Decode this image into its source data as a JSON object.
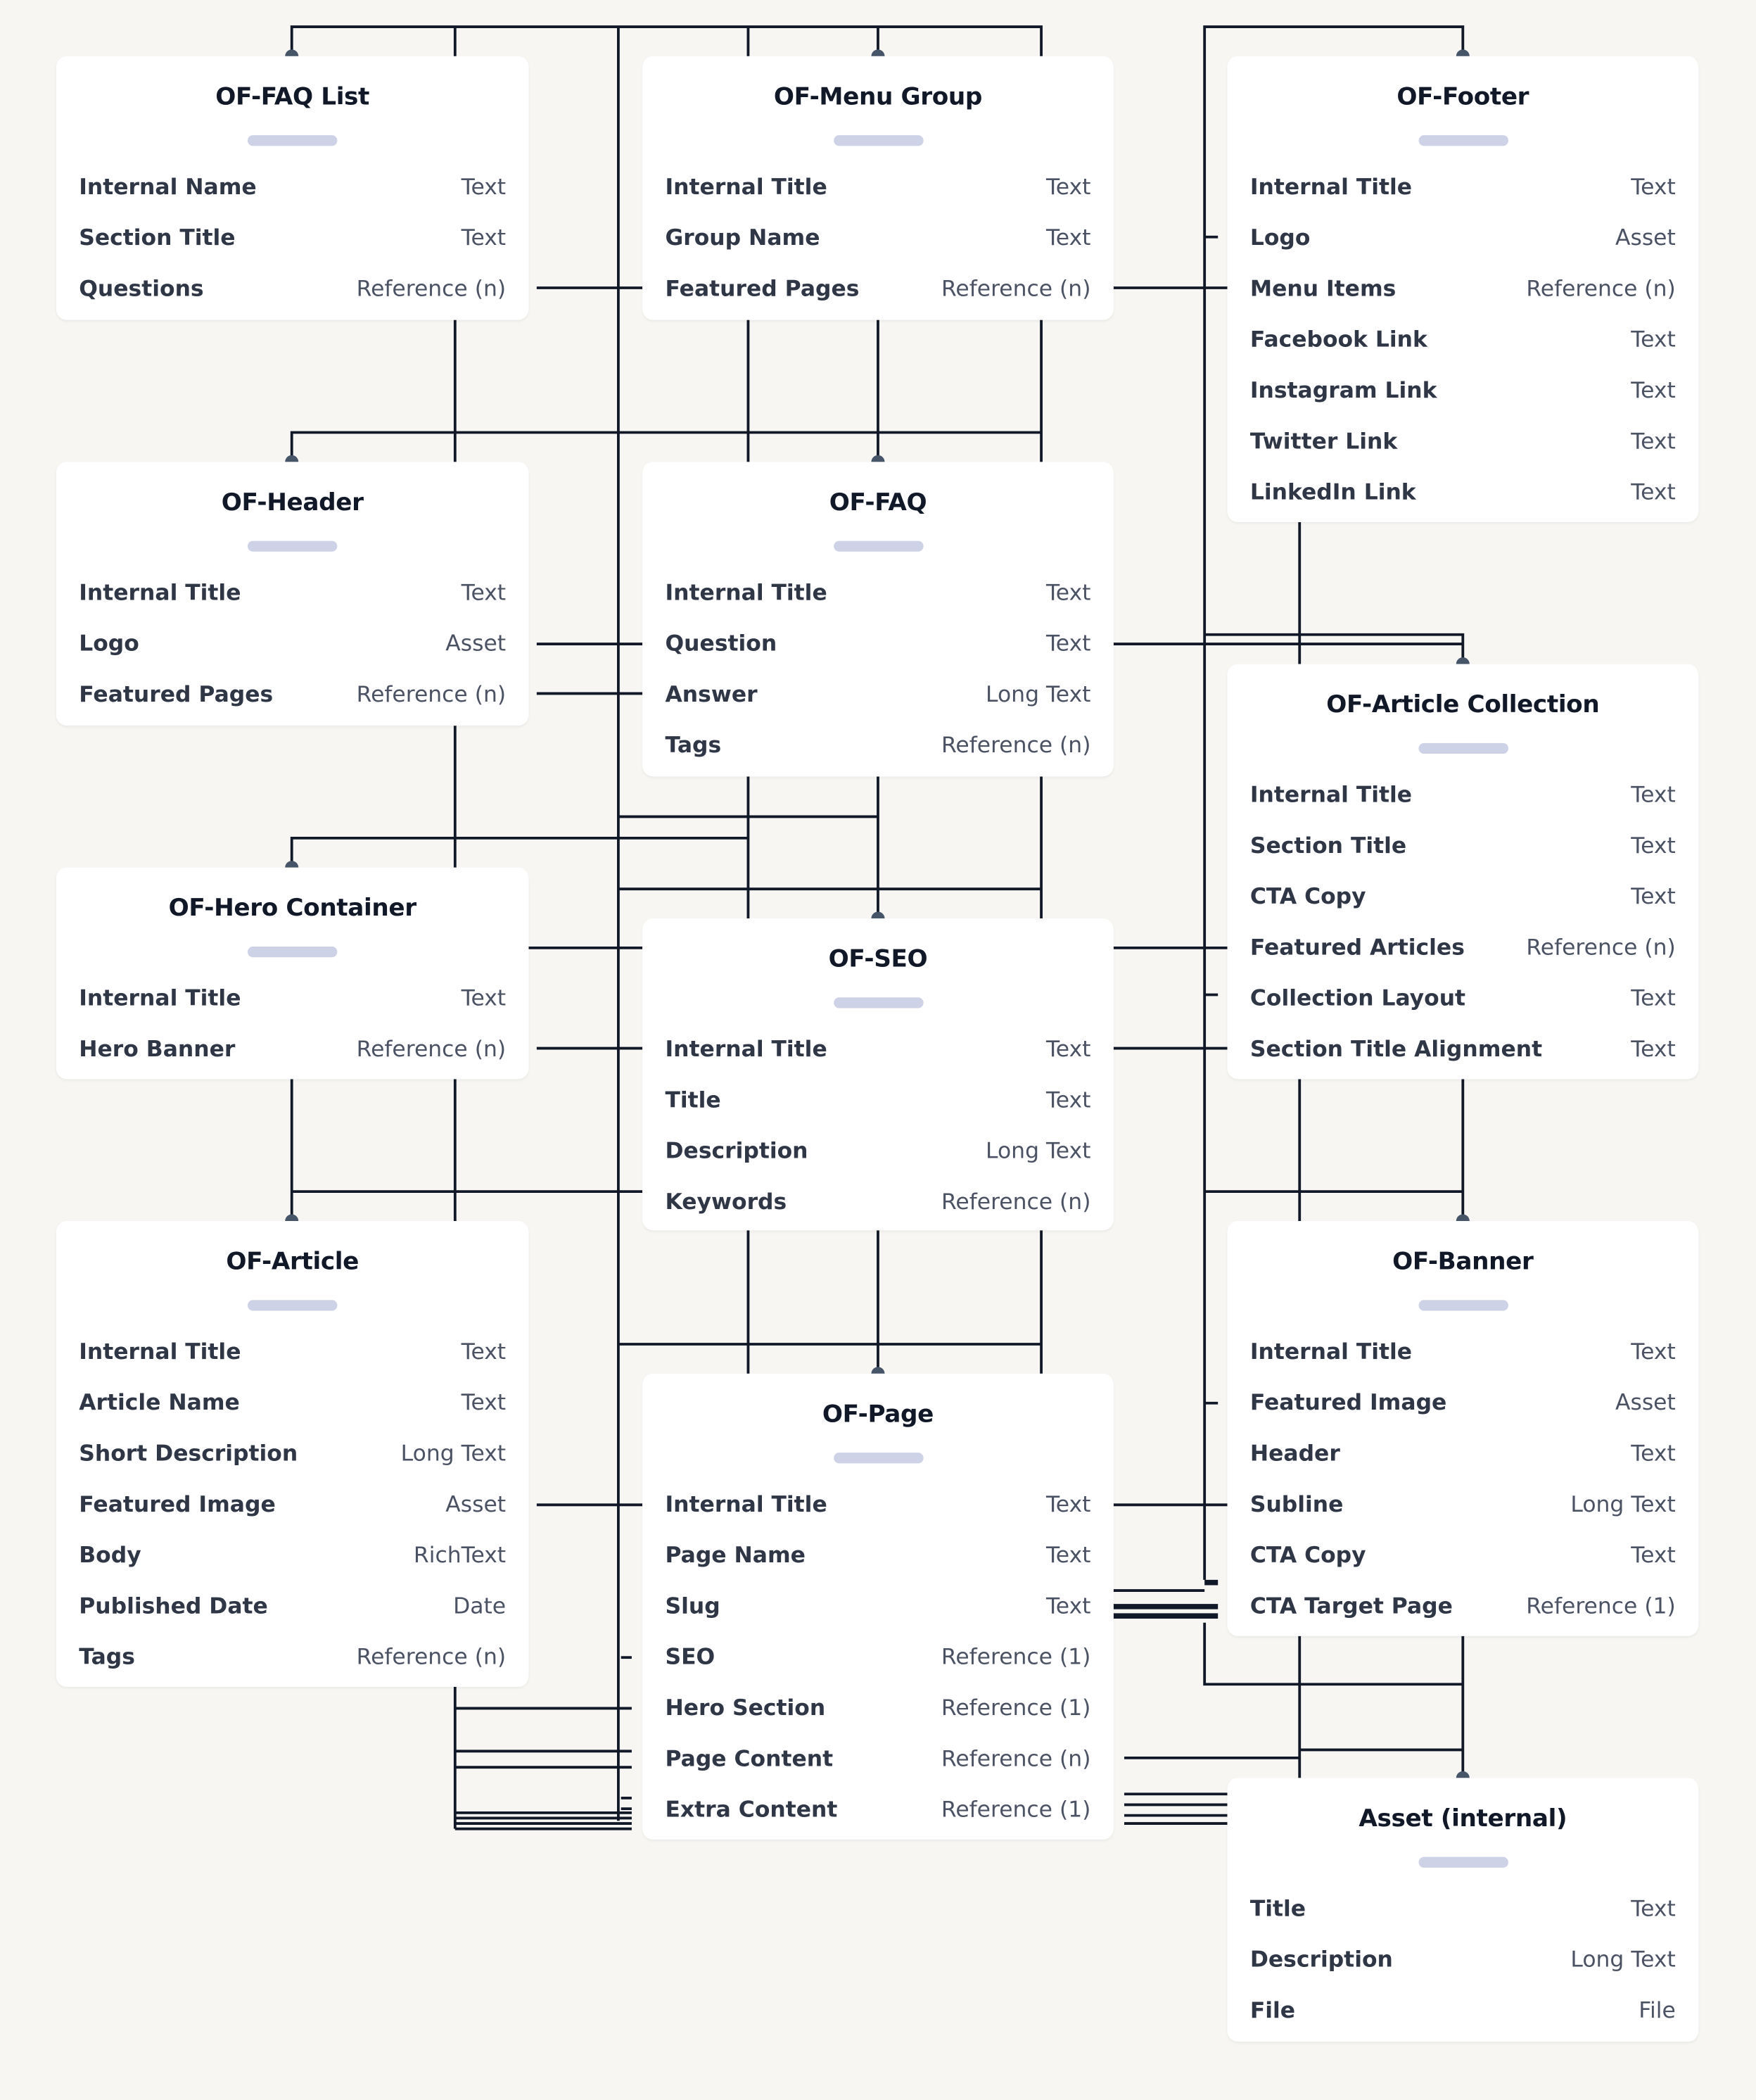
{
  "diagram": {
    "type": "content-model-entity-relationship",
    "entities": [
      {
        "id": "faq-list",
        "title": "OF-FAQ List",
        "fields": [
          {
            "name": "Internal Name",
            "type": "Text"
          },
          {
            "name": "Section Title",
            "type": "Text"
          },
          {
            "name": "Questions",
            "type": "Reference (n)"
          }
        ]
      },
      {
        "id": "menu-group",
        "title": "OF-Menu Group",
        "fields": [
          {
            "name": "Internal Title",
            "type": "Text"
          },
          {
            "name": "Group Name",
            "type": "Text"
          },
          {
            "name": "Featured Pages",
            "type": "Reference (n)"
          }
        ]
      },
      {
        "id": "footer",
        "title": "OF-Footer",
        "fields": [
          {
            "name": "Internal Title",
            "type": "Text"
          },
          {
            "name": "Logo",
            "type": "Asset"
          },
          {
            "name": "Menu Items",
            "type": "Reference (n)"
          },
          {
            "name": "Facebook Link",
            "type": "Text"
          },
          {
            "name": "Instagram Link",
            "type": "Text"
          },
          {
            "name": "Twitter Link",
            "type": "Text"
          },
          {
            "name": "LinkedIn Link",
            "type": "Text"
          }
        ]
      },
      {
        "id": "header",
        "title": "OF-Header",
        "fields": [
          {
            "name": "Internal Title",
            "type": "Text"
          },
          {
            "name": "Logo",
            "type": "Asset"
          },
          {
            "name": "Featured Pages",
            "type": "Reference (n)"
          }
        ]
      },
      {
        "id": "faq",
        "title": "OF-FAQ",
        "fields": [
          {
            "name": "Internal Title",
            "type": "Text"
          },
          {
            "name": "Question",
            "type": "Text"
          },
          {
            "name": "Answer",
            "type": "Long Text"
          },
          {
            "name": "Tags",
            "type": "Reference (n)"
          }
        ]
      },
      {
        "id": "article-collection",
        "title": "OF-Article Collection",
        "fields": [
          {
            "name": "Internal Title",
            "type": "Text"
          },
          {
            "name": "Section Title",
            "type": "Text"
          },
          {
            "name": "CTA Copy",
            "type": "Text"
          },
          {
            "name": "Featured Articles",
            "type": "Reference (n)"
          },
          {
            "name": "Collection Layout",
            "type": "Text"
          },
          {
            "name": "Section Title Alignment",
            "type": "Text"
          }
        ]
      },
      {
        "id": "hero-container",
        "title": "OF-Hero Container",
        "fields": [
          {
            "name": "Internal Title",
            "type": "Text"
          },
          {
            "name": "Hero Banner",
            "type": "Reference (n)"
          }
        ]
      },
      {
        "id": "seo",
        "title": "OF-SEO",
        "fields": [
          {
            "name": "Internal Title",
            "type": "Text"
          },
          {
            "name": "Title",
            "type": "Text"
          },
          {
            "name": "Description",
            "type": "Long Text"
          },
          {
            "name": "Keywords",
            "type": "Reference (n)"
          }
        ]
      },
      {
        "id": "article",
        "title": "OF-Article",
        "fields": [
          {
            "name": "Internal Title",
            "type": "Text"
          },
          {
            "name": "Article Name",
            "type": "Text"
          },
          {
            "name": "Short Description",
            "type": "Long Text"
          },
          {
            "name": "Featured Image",
            "type": "Asset"
          },
          {
            "name": "Body",
            "type": "RichText"
          },
          {
            "name": "Published Date",
            "type": "Date"
          },
          {
            "name": "Tags",
            "type": "Reference (n)"
          }
        ]
      },
      {
        "id": "banner",
        "title": "OF-Banner",
        "fields": [
          {
            "name": "Internal Title",
            "type": "Text"
          },
          {
            "name": "Featured Image",
            "type": "Asset"
          },
          {
            "name": "Header",
            "type": "Text"
          },
          {
            "name": "Subline",
            "type": "Long Text"
          },
          {
            "name": "CTA Copy",
            "type": "Text"
          },
          {
            "name": "CTA Target Page",
            "type": "Reference (1)"
          }
        ]
      },
      {
        "id": "page",
        "title": "OF-Page",
        "fields": [
          {
            "name": "Internal Title",
            "type": "Text"
          },
          {
            "name": "Page Name",
            "type": "Text"
          },
          {
            "name": "Slug",
            "type": "Text"
          },
          {
            "name": "SEO",
            "type": "Reference (1)"
          },
          {
            "name": "Hero Section",
            "type": "Reference (1)"
          },
          {
            "name": "Page Content",
            "type": "Reference (n)"
          },
          {
            "name": "Extra Content",
            "type": "Reference (1)"
          }
        ]
      },
      {
        "id": "asset",
        "title": "Asset (internal)",
        "fields": [
          {
            "name": "Title",
            "type": "Text"
          },
          {
            "name": "Description",
            "type": "Long Text"
          },
          {
            "name": "File",
            "type": "File"
          }
        ]
      }
    ],
    "colors": {
      "background": "#f7f6f3",
      "card": "#ffffff",
      "connector": "#111827",
      "anchor": "#475569",
      "pill": "#cdd2e6",
      "title_text": "#111827",
      "field_name": "#2f3645",
      "field_type": "#4b5263"
    }
  }
}
